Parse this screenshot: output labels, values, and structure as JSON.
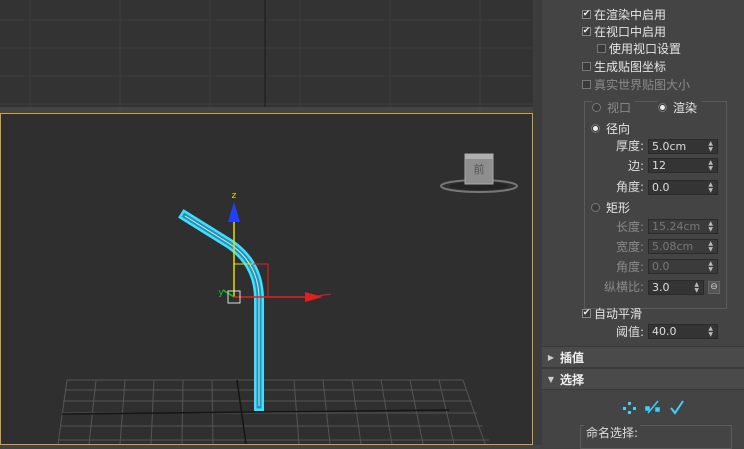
{
  "panel": {
    "enable_in_render": "在渲染中启用",
    "enable_in_viewport": "在视口中启用",
    "use_viewport_settings": "使用视口设置",
    "generate_mapping_coords": "生成贴图坐标",
    "real_world_map_size": "真实世界贴图大小",
    "viewport_radio": "视口",
    "render_radio": "渲染",
    "radial": "径向",
    "thickness_label": "厚度:",
    "thickness_value": "5.0cm",
    "sides_label": "边:",
    "sides_value": "12",
    "angle_label": "角度:",
    "angle_value": "0.0",
    "rectangular": "矩形",
    "length_label": "长度:",
    "length_value": "15.24cm",
    "width_label": "宽度:",
    "width_value": "5.08cm",
    "angle2_label": "角度:",
    "angle2_value": "0.0",
    "aspect_label": "纵横比:",
    "aspect_value": "3.0",
    "auto_smooth": "自动平滑",
    "threshold_label": "阈值:",
    "threshold_value": "40.0",
    "interpolation_rollout": "插值",
    "selection_rollout": "选择",
    "named_selection": "命名选择:"
  },
  "viewport": {
    "axis_z": "z",
    "axis_x": "x",
    "axis_y": "y",
    "viewcube_face": "前"
  },
  "colors": {
    "spline": "#3fe0ff",
    "active_border": "#d2a03c",
    "axis_x": "#e02020",
    "axis_y": "#20c020",
    "axis_z": "#2040ff"
  }
}
